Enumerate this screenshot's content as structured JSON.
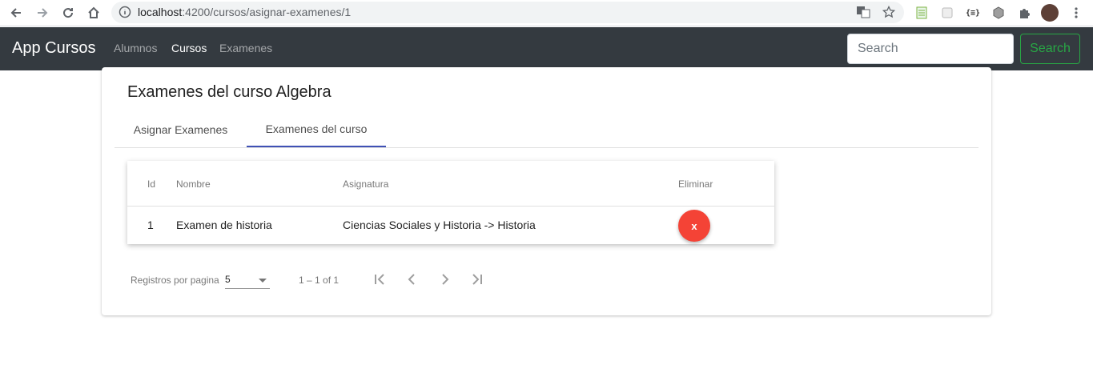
{
  "browser": {
    "url_host": "localhost",
    "url_rest": ":4200/cursos/asignar-examenes/1",
    "icons": [
      "back-arrow-icon",
      "forward-arrow-icon",
      "reload-icon",
      "home-icon",
      "info-icon",
      "translate-icon",
      "star-icon",
      "extension-icon",
      "puzzle-icon",
      "avatar"
    ]
  },
  "navbar": {
    "brand": "App Cursos",
    "links": [
      {
        "label": "Alumnos",
        "active": false
      },
      {
        "label": "Cursos",
        "active": true
      },
      {
        "label": "Examenes",
        "active": false
      }
    ],
    "search_placeholder": "Search",
    "search_button": "Search"
  },
  "card": {
    "title": "Examenes del curso Algebra",
    "tabs": [
      {
        "label": "Asignar Examenes",
        "active": false
      },
      {
        "label": "Examenes del curso",
        "active": true
      }
    ]
  },
  "table": {
    "headers": {
      "id": "Id",
      "nombre": "Nombre",
      "asignatura": "Asignatura",
      "eliminar": "Eliminar"
    },
    "rows": [
      {
        "id": "1",
        "nombre": "Examen de historia",
        "asignatura": "Ciencias Sociales y Historia -> Historia",
        "delete_label": "x"
      }
    ]
  },
  "paginator": {
    "label": "Registros por pagina",
    "page_size": "5",
    "range": "1 – 1 of 1"
  },
  "colors": {
    "navbar_bg": "#343a40",
    "accent_tab": "#3f51b5",
    "delete_button": "#f44336",
    "search_button": "#28a745"
  }
}
